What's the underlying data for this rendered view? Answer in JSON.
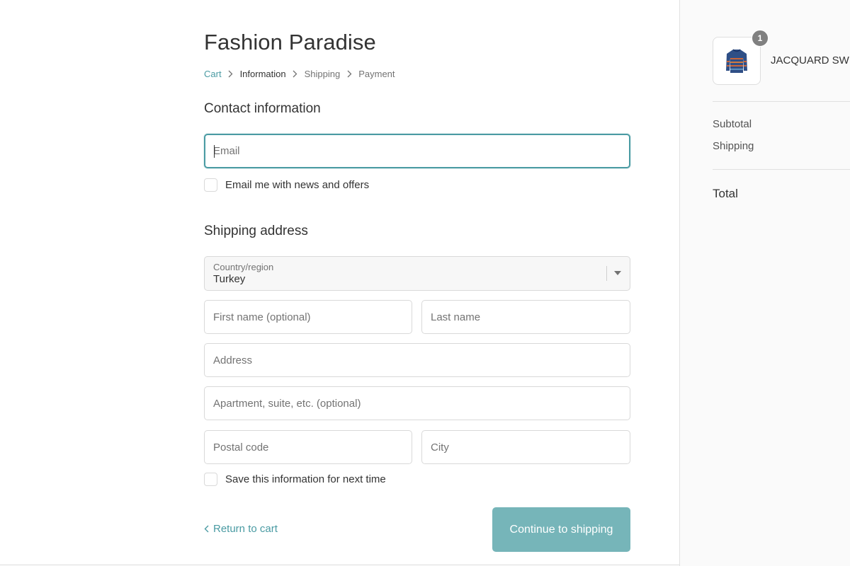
{
  "shop": {
    "title": "Fashion Paradise"
  },
  "breadcrumb": {
    "cart": "Cart",
    "information": "Information",
    "shipping": "Shipping",
    "payment": "Payment"
  },
  "contact": {
    "title": "Contact information",
    "email_placeholder": "Email",
    "email_value": "",
    "news_label": "Email me with news and offers"
  },
  "shipping_address": {
    "title": "Shipping address",
    "country_label": "Country/region",
    "country_value": "Turkey",
    "first_name_placeholder": "First name (optional)",
    "last_name_placeholder": "Last name",
    "address_placeholder": "Address",
    "apartment_placeholder": "Apartment, suite, etc. (optional)",
    "postal_placeholder": "Postal code",
    "city_placeholder": "City",
    "save_label": "Save this information for next time"
  },
  "actions": {
    "return_label": "Return to cart",
    "continue_label": "Continue to shipping"
  },
  "summary": {
    "quantity": "1",
    "product_name": "JACQUARD SWEATER",
    "subtotal_label": "Subtotal",
    "shipping_label": "Shipping",
    "total_label": "Total"
  },
  "colors": {
    "accent": "#4a9ba3",
    "button": "#76b5b9",
    "sidebar_bg": "#fafafa"
  }
}
